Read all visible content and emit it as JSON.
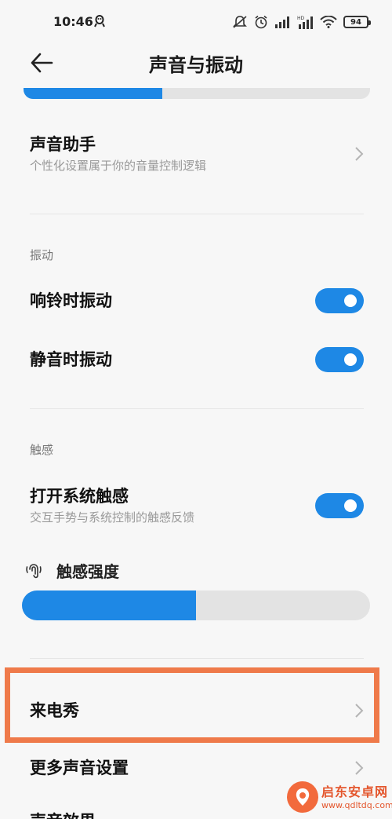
{
  "status_bar": {
    "time": "10:46",
    "icons": [
      "notification-icon",
      "mute-vibrate-icon",
      "alarm-icon",
      "signal-icon",
      "hd-signal-icon",
      "wifi-icon"
    ],
    "battery": "94"
  },
  "header": {
    "back_icon": "arrow-left-icon",
    "title": "声音与振动"
  },
  "top_slider": {
    "value_fraction": 0.4
  },
  "sound_assistant": {
    "title": "声音助手",
    "subtitle": "个性化设置属于你的音量控制逻辑"
  },
  "vibration_section": {
    "label": "振动",
    "items": [
      {
        "title": "响铃时振动",
        "enabled": true
      },
      {
        "title": "静音时振动",
        "enabled": true
      }
    ]
  },
  "haptics_section": {
    "label": "触感",
    "system_haptics": {
      "title": "打开系统触感",
      "subtitle": "交互手势与系统控制的触感反馈",
      "enabled": true
    },
    "intensity": {
      "label": "触感强度",
      "icon": "haptic-fingerprint-icon",
      "value_fraction": 0.5
    }
  },
  "caller_show": {
    "title": "来电秀"
  },
  "more_sound_settings": {
    "title": "更多声音设置"
  },
  "partial_row": {
    "title": "声音效果"
  },
  "watermark": {
    "title": "启东安卓网",
    "url": "www.qdltdq.com"
  },
  "colors": {
    "accent": "#1e88e5",
    "highlight": "#ef7a4a",
    "track": "#e3e3e3",
    "background": "#f7f7f7"
  }
}
